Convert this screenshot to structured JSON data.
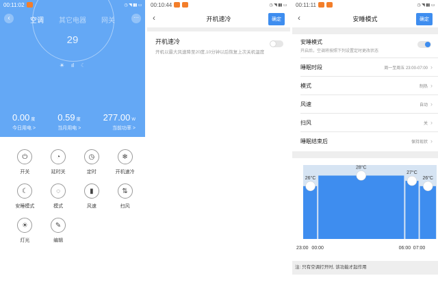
{
  "panel1": {
    "status": {
      "time": "00:11:02",
      "badge_color": "#F37E2A"
    },
    "tabs": [
      "空调",
      "其它电器",
      "网关"
    ],
    "temperature": "29",
    "stats": [
      {
        "value": "0.00",
        "unit": "度",
        "label": "今日用电 >"
      },
      {
        "value": "0.59",
        "unit": "度",
        "label": "当月用电 >"
      },
      {
        "value": "277.00",
        "unit": "W",
        "label": "当前功率 >"
      }
    ],
    "controls": [
      {
        "label": "开关",
        "icon": "power-icon",
        "glyph": "⏻"
      },
      {
        "label": "延时关",
        "icon": "delay-off-icon",
        "glyph": "◔"
      },
      {
        "label": "定时",
        "icon": "timer-icon",
        "glyph": "◷"
      },
      {
        "label": "开机速冷",
        "icon": "snowflake-icon",
        "glyph": "❄"
      },
      {
        "label": "安睡模式",
        "icon": "moon-icon",
        "glyph": "☾"
      },
      {
        "label": "模式",
        "icon": "mode-icon",
        "glyph": "◌"
      },
      {
        "label": "风速",
        "icon": "fan-speed-icon",
        "glyph": "▮"
      },
      {
        "label": "扫风",
        "icon": "swing-icon",
        "glyph": "⇅"
      },
      {
        "label": "灯光",
        "icon": "bulb-icon",
        "glyph": "☀"
      },
      {
        "label": "编辑",
        "icon": "edit-icon",
        "glyph": "✎"
      }
    ],
    "accent": "#64A8F5"
  },
  "panel2": {
    "status": {
      "time": "00:10:44",
      "badge_color": "#F37E2A"
    },
    "title": "开机速冷",
    "confirm": "确定",
    "item": {
      "title": "开机速冷",
      "desc": "开机以最大风速降至20度,10分钟以后恢复上次关机温度",
      "enabled": false
    }
  },
  "panel3": {
    "status": {
      "time": "00:11:11",
      "badge_color": "#F37E2A"
    },
    "title": "安睡模式",
    "confirm": "确定",
    "sleep": {
      "title": "安睡模式",
      "desc": "开启后，空调将按照下列设置定时更改状态",
      "enabled": true
    },
    "settings": [
      {
        "key": "睡眠时段",
        "value": "周一至周五 23:00-07:00"
      },
      {
        "key": "模式",
        "value": "制热"
      },
      {
        "key": "风速",
        "value": "自动"
      },
      {
        "key": "扫风",
        "value": "关"
      },
      {
        "key": "睡眠结束后",
        "value": "保持现状"
      }
    ],
    "note": "注: 只有空调打开时, 该功能才起作用",
    "accent": "#3E8DEF"
  },
  "chart_data": {
    "type": "bar",
    "categories": [
      "23:00-00:00",
      "00:00-06:00",
      "06:00-07:00",
      "07:00-"
    ],
    "x_ticks": [
      "23:00",
      "00:00",
      "06:00",
      "07:00"
    ],
    "values": [
      26,
      28,
      27,
      26
    ],
    "value_labels": [
      "26°C",
      "28°C",
      "27°C",
      "26°C"
    ],
    "durations": [
      1,
      6,
      1,
      1.2
    ],
    "ylim": [
      16,
      30
    ],
    "title": "",
    "xlabel": "",
    "ylabel": ""
  }
}
